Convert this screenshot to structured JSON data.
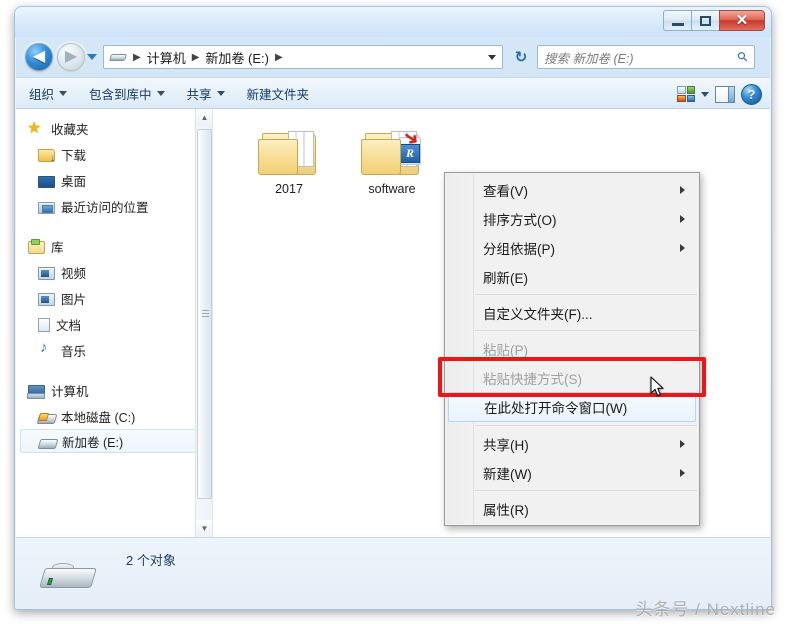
{
  "window": {
    "controls": {
      "minimize": "–",
      "maximize": "▢",
      "close": "✕"
    }
  },
  "nav": {
    "back_icon": "◀",
    "forward_icon": "▶",
    "refresh_icon": "↻",
    "breadcrumbs": [
      "计算机",
      "新加卷 (E:)"
    ],
    "separator": "▶"
  },
  "search": {
    "placeholder": "搜索 新加卷 (E:)",
    "icon": "search-icon"
  },
  "toolbar": {
    "items": [
      {
        "label": "组织",
        "has_caret": true
      },
      {
        "label": "包含到库中",
        "has_caret": true
      },
      {
        "label": "共享",
        "has_caret": true
      },
      {
        "label": "新建文件夹",
        "has_caret": false
      }
    ],
    "help_label": "?"
  },
  "sidebar": {
    "groups": [
      {
        "root": {
          "label": "收藏夹",
          "icon": "star-icon"
        },
        "items": [
          {
            "label": "下载",
            "icon": "download-folder-icon"
          },
          {
            "label": "桌面",
            "icon": "desktop-icon"
          },
          {
            "label": "最近访问的位置",
            "icon": "recent-places-icon"
          }
        ]
      },
      {
        "root": {
          "label": "库",
          "icon": "library-icon"
        },
        "items": [
          {
            "label": "视频",
            "icon": "video-icon"
          },
          {
            "label": "图片",
            "icon": "pictures-icon"
          },
          {
            "label": "文档",
            "icon": "documents-icon"
          },
          {
            "label": "音乐",
            "icon": "music-icon"
          }
        ]
      },
      {
        "root": {
          "label": "计算机",
          "icon": "computer-icon"
        },
        "items": [
          {
            "label": "本地磁盘 (C:)",
            "icon": "hard-drive-icon",
            "selected": false
          },
          {
            "label": "新加卷 (E:)",
            "icon": "drive-icon",
            "selected": true
          }
        ]
      }
    ]
  },
  "files": [
    {
      "name": "2017",
      "icon": "folder-icon"
    },
    {
      "name": "software",
      "icon": "folder-with-r-shortcut-icon"
    }
  ],
  "status": {
    "text": "2 个对象",
    "icon": "drive-icon"
  },
  "context_menu": {
    "items": [
      {
        "label": "查看(V)",
        "submenu": true,
        "disabled": false,
        "highlight": false
      },
      {
        "label": "排序方式(O)",
        "submenu": true,
        "disabled": false,
        "highlight": false
      },
      {
        "label": "分组依据(P)",
        "submenu": true,
        "disabled": false,
        "highlight": false
      },
      {
        "label": "刷新(E)",
        "submenu": false,
        "disabled": false,
        "highlight": false
      },
      {
        "separator": true
      },
      {
        "label": "自定义文件夹(F)...",
        "submenu": false,
        "disabled": false,
        "highlight": false
      },
      {
        "separator": true
      },
      {
        "label": "粘贴(P)",
        "submenu": false,
        "disabled": true,
        "highlight": false
      },
      {
        "label": "粘贴快捷方式(S)",
        "submenu": false,
        "disabled": true,
        "highlight": false
      },
      {
        "label": "在此处打开命令窗口(W)",
        "submenu": false,
        "disabled": false,
        "highlight": true
      },
      {
        "separator": true
      },
      {
        "label": "共享(H)",
        "submenu": true,
        "disabled": false,
        "highlight": false
      },
      {
        "label": "新建(W)",
        "submenu": true,
        "disabled": false,
        "highlight": false
      },
      {
        "separator": true
      },
      {
        "label": "属性(R)",
        "submenu": false,
        "disabled": false,
        "highlight": false
      }
    ]
  },
  "annotation": {
    "highlight_color": "#f01515"
  },
  "watermark": {
    "text": "头条号 / Nextline"
  }
}
